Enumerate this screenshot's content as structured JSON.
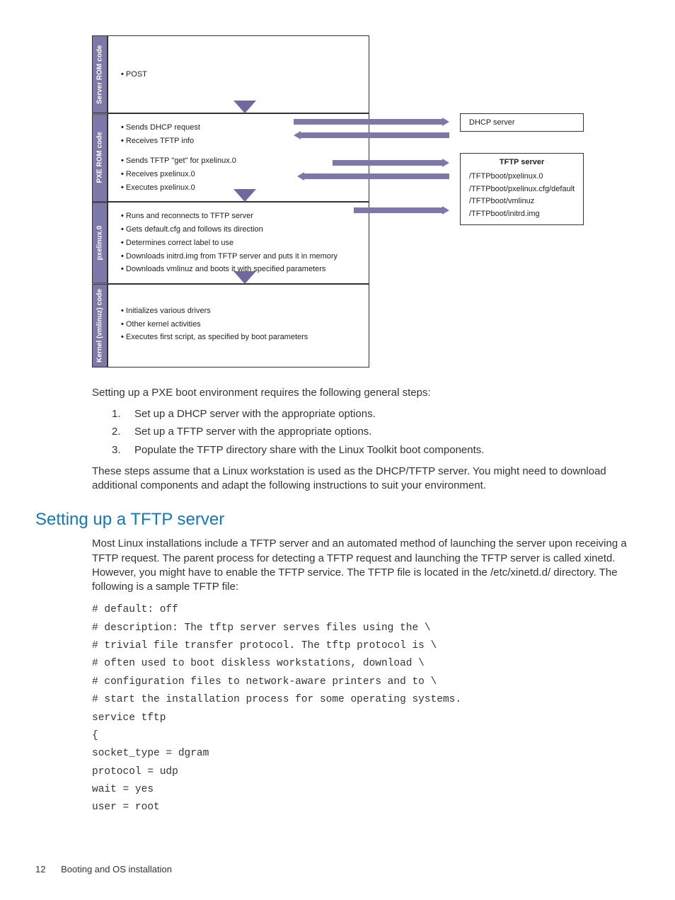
{
  "diagram": {
    "stage1": {
      "label": "Server ROM code",
      "items": [
        "POST"
      ]
    },
    "stage2": {
      "label": "PXE ROM code",
      "items": [
        "Sends DHCP request",
        "Receives TFTP info",
        "Sends TFTP \"get\" for pxelinux.0",
        "Receives pxelinux.0",
        "Executes pxelinux.0"
      ]
    },
    "stage3": {
      "label": "pxelinux.0",
      "items": [
        "Runs and reconnects to TFTP server",
        "Gets default.cfg and follows its direction",
        "Determines correct label to use",
        "Downloads initrd.img from TFTP server and puts it in memory",
        "Downloads vmlinuz and boots it with specified parameters"
      ]
    },
    "stage4": {
      "label": "Kernel (vmlinuz) code",
      "items": [
        "Initializes various drivers",
        "Other kernel activities",
        "Executes first script, as specified by boot parameters"
      ]
    },
    "dhcp": {
      "title": "DHCP server"
    },
    "tftp": {
      "title": "TFTP server",
      "lines": [
        "/TFTPboot/pxelinux.0",
        "/TFTPboot/pxelinux.cfg/default",
        "/TFTPboot/vmlinuz",
        "/TFTPboot/initrd.img"
      ]
    }
  },
  "intro": "Setting up a PXE boot environment requires the following general steps:",
  "steps": [
    "Set up a DHCP server with the appropriate options.",
    "Set up a TFTP server with the appropriate options.",
    "Populate the TFTP directory share with the Linux Toolkit boot components."
  ],
  "note": "These steps assume that a Linux workstation is used as the DHCP/TFTP server. You might need to download additional components and adapt the following instructions to suit your environment.",
  "section_title": "Setting up a TFTP server",
  "section_body": "Most Linux installations include a TFTP server and an automated method of launching the server upon receiving a TFTP request. The parent process for detecting a TFTP request and launching the TFTP server is called xinetd. However, you might have to enable the TFTP service. The TFTP file is located in the /etc/xinetd.d/ directory. The following is a sample TFTP file:",
  "code_lines": [
    "# default: off",
    "# description: The tftp server serves files using the \\",
    "# trivial file transfer protocol. The tftp protocol is \\",
    "# often used to boot diskless workstations, download \\",
    "# configuration files to network-aware printers and to \\",
    "# start the installation process for some operating systems.",
    "service tftp",
    "{",
    "socket_type = dgram",
    "protocol = udp",
    "wait = yes",
    "user = root"
  ],
  "footer": {
    "page_number": "12",
    "chapter": "Booting and OS installation"
  }
}
